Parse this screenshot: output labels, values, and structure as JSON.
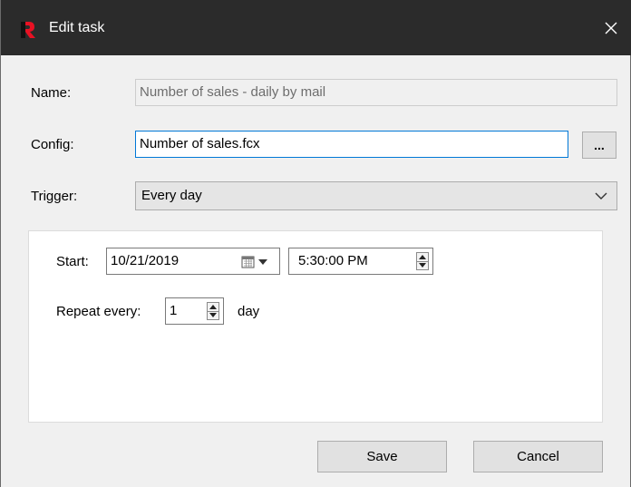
{
  "window": {
    "title": "Edit task",
    "app_icon": "app-logo-icon",
    "close_icon": "close-icon"
  },
  "form": {
    "name_label": "Name:",
    "name_value": "Number of sales - daily by mail",
    "config_label": "Config:",
    "config_value": "Number of sales.fcx",
    "browse_label": "...",
    "trigger_label": "Trigger:",
    "trigger_value": "Every day"
  },
  "schedule": {
    "start_label": "Start:",
    "start_date": "10/21/2019",
    "start_time": "5:30:00 PM",
    "repeat_label": "Repeat every:",
    "repeat_value": "1",
    "repeat_unit": "day"
  },
  "buttons": {
    "save": "Save",
    "cancel": "Cancel"
  },
  "colors": {
    "titlebar": "#2b2b2b",
    "app_icon_red": "#e81123",
    "focus_border": "#0078d7"
  }
}
